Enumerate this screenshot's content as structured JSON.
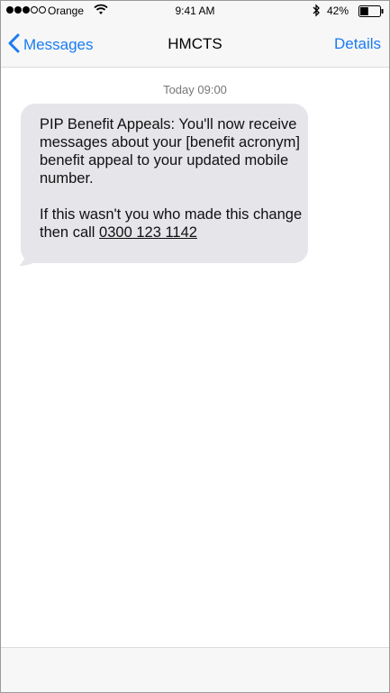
{
  "status_bar": {
    "signal": [
      true,
      true,
      true,
      false,
      false
    ],
    "carrier": "Orange",
    "time": "9:41 AM",
    "battery_percent": "42%",
    "battery_level": 0.42,
    "icons": [
      "wifi-icon",
      "bluetooth-icon",
      "battery-icon"
    ]
  },
  "nav": {
    "back_label": "Messages",
    "title": "HMCTS",
    "details_label": "Details",
    "accent_color": "#1a7cf2"
  },
  "conversation": {
    "timestamp": "Today 09:00",
    "message": {
      "paragraph1": "PIP Benefit Appeals: You'll now receive messages about your [benefit acronym] benefit appeal to your updated mobile number.",
      "paragraph2_prefix": "If this wasn't you who made this change then call ",
      "phone_number": "0300 123 1142"
    },
    "bubble_color": "#e5e5ea"
  }
}
